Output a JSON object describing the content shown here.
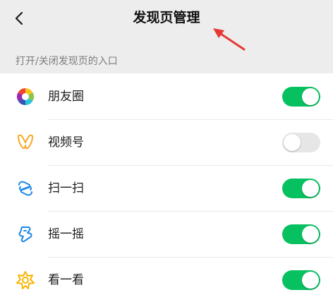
{
  "nav": {
    "title": "发现页管理",
    "back_icon": "chevron-left-icon"
  },
  "section": {
    "header": "打开/关闭发现页的入口"
  },
  "items": [
    {
      "label": "朋友圈",
      "icon": "moments-icon",
      "enabled": true
    },
    {
      "label": "视频号",
      "icon": "channels-icon",
      "enabled": false
    },
    {
      "label": "扫一扫",
      "icon": "scan-icon",
      "enabled": true
    },
    {
      "label": "摇一摇",
      "icon": "shake-icon",
      "enabled": true
    },
    {
      "label": "看一看",
      "icon": "top-stories-icon",
      "enabled": true
    }
  ],
  "colors": {
    "switch_on": "#07c160",
    "switch_off": "#e6e6e6",
    "annotation_arrow": "#e53935"
  }
}
